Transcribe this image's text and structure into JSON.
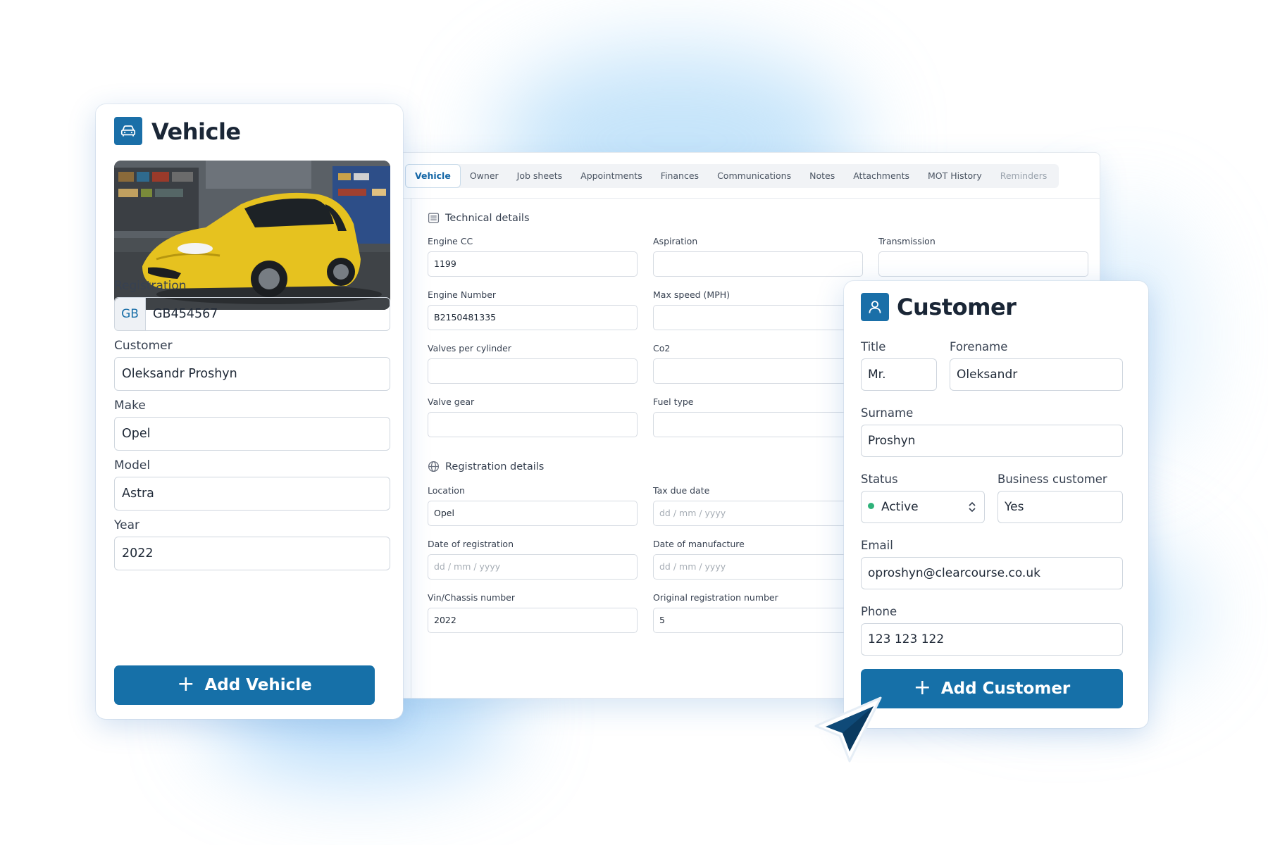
{
  "tabs": [
    {
      "label": "Vehicle",
      "state": "active"
    },
    {
      "label": "Owner",
      "state": "normal"
    },
    {
      "label": "Job sheets",
      "state": "normal"
    },
    {
      "label": "Appointments",
      "state": "normal"
    },
    {
      "label": "Finances",
      "state": "normal"
    },
    {
      "label": "Communications",
      "state": "normal"
    },
    {
      "label": "Notes",
      "state": "normal"
    },
    {
      "label": "Attachments",
      "state": "normal"
    },
    {
      "label": "MOT History",
      "state": "normal"
    },
    {
      "label": "Reminders",
      "state": "muted"
    }
  ],
  "technical": {
    "title": "Technical details",
    "icon": "document-icon",
    "fields": {
      "engine_cc": {
        "label": "Engine CC",
        "value": "1199"
      },
      "aspiration": {
        "label": "Aspiration",
        "value": ""
      },
      "transmission": {
        "label": "Transmission",
        "value": ""
      },
      "engine_number": {
        "label": "Engine Number",
        "value": "B2150481335"
      },
      "max_speed": {
        "label": "Max speed (MPH)",
        "value": ""
      },
      "valves": {
        "label": "Valves per cylinder",
        "value": ""
      },
      "co2": {
        "label": "Co2",
        "value": ""
      },
      "valve_gear": {
        "label": "Valve gear",
        "value": ""
      },
      "fuel_type": {
        "label": "Fuel type",
        "value": ""
      }
    }
  },
  "registration": {
    "title": "Registration details",
    "icon": "globe-icon",
    "fields": {
      "location": {
        "label": "Location",
        "value": "Opel"
      },
      "tax_due": {
        "label": "Tax due date",
        "placeholder": "dd / mm / yyyy"
      },
      "date_reg": {
        "label": "Date of registration",
        "placeholder": "dd / mm / yyyy"
      },
      "date_manuf": {
        "label": "Date of manufacture",
        "placeholder": "dd / mm / yyyy"
      },
      "vin": {
        "label": "Vin/Chassis number",
        "value": "2022"
      },
      "orig_reg": {
        "label": "Original registration number",
        "value": "5"
      }
    }
  },
  "vehicle_card": {
    "title": "Vehicle",
    "icon": "car-icon",
    "photo": "yellow-hatchback-in-garage",
    "registration_label": "Registration",
    "registration_prefix": "GB",
    "registration_value": "GB454567",
    "customer_label": "Customer",
    "customer_value": "Oleksandr Proshyn",
    "make_label": "Make",
    "make_value": "Opel",
    "model_label": "Model",
    "model_value": "Astra",
    "year_label": "Year",
    "year_value": "2022",
    "button_label": "Add Vehicle"
  },
  "customer_card": {
    "title": "Customer",
    "icon": "user-icon",
    "title_label": "Title",
    "title_value": "Mr.",
    "forename_label": "Forename",
    "forename_value": "Oleksandr",
    "surname_label": "Surname",
    "surname_value": "Proshyn",
    "status_label": "Status",
    "status_value": "Active",
    "business_label": "Business customer",
    "business_value": "Yes",
    "email_label": "Email",
    "email_value": "oproshyn@clearcourse.co.uk",
    "phone_label": "Phone",
    "phone_value": "123 123 122",
    "button_label": "Add Customer"
  },
  "colors": {
    "accent": "#1670a8",
    "status_active": "#2fb27a",
    "cursor": "#0f4a78"
  }
}
